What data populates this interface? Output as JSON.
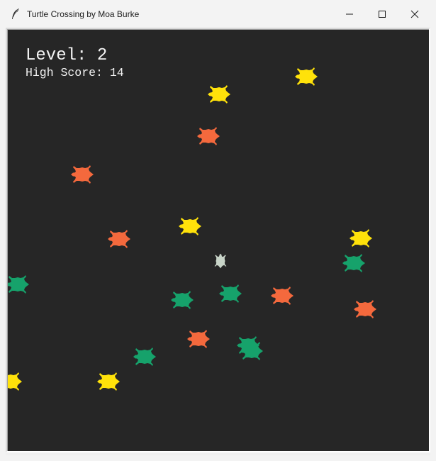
{
  "window": {
    "title": "Turtle Crossing by Moa Burke",
    "icon": "feather-icon",
    "controls": [
      "minimize-icon",
      "maximize-icon",
      "close-icon"
    ]
  },
  "hud": {
    "level_text": "Level: 2",
    "high_score_text": "High Score: 14"
  },
  "colors": {
    "background": "#262626",
    "text": "#f2f2f2",
    "yellow": "#ffe20a",
    "orange": "#f4693d",
    "green": "#16a26b",
    "player": "#c8d4c8"
  },
  "player": {
    "color": "player"
  },
  "cars": [
    {
      "color": "yellow"
    },
    {
      "color": "yellow"
    },
    {
      "color": "orange"
    },
    {
      "color": "orange"
    },
    {
      "color": "yellow"
    },
    {
      "color": "orange"
    },
    {
      "color": "yellow"
    },
    {
      "color": "green"
    },
    {
      "color": "green"
    },
    {
      "color": "green"
    },
    {
      "color": "green"
    },
    {
      "color": "orange"
    },
    {
      "color": "green"
    },
    {
      "color": "orange"
    },
    {
      "color": "green"
    },
    {
      "color": "orange"
    },
    {
      "color": "green"
    },
    {
      "color": "yellow"
    },
    {
      "color": "yellow"
    }
  ]
}
